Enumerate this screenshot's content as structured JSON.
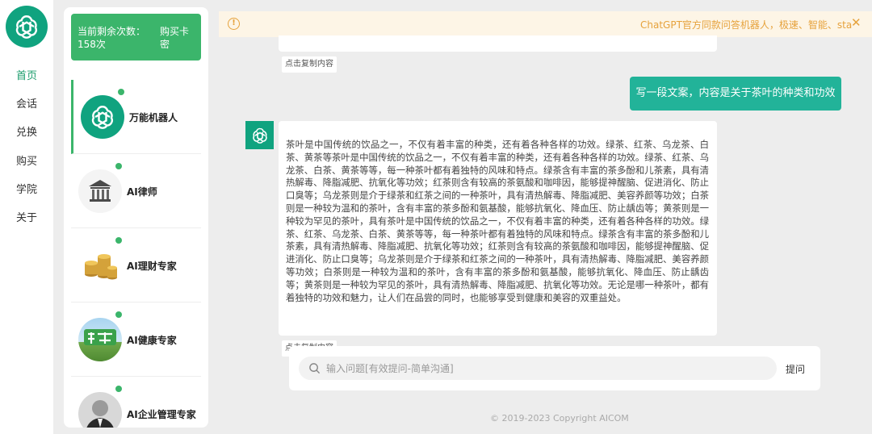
{
  "nav": {
    "logo_icon": "openai-logo-icon",
    "items": [
      {
        "label": "首页",
        "active": true
      },
      {
        "label": "会话"
      },
      {
        "label": "兑换"
      },
      {
        "label": "购买"
      },
      {
        "label": "学院"
      },
      {
        "label": "关于"
      }
    ]
  },
  "credits": {
    "count_label": "当前剩余次数：158次",
    "buy_label": "购买卡密"
  },
  "bots": [
    {
      "name": "万能机器人",
      "icon": "openai-logo-icon",
      "active": true
    },
    {
      "name": "AI律师",
      "icon": "courthouse-icon"
    },
    {
      "name": "AI理财专家",
      "icon": "coins-icon"
    },
    {
      "name": "AI健康专家",
      "icon": "health-icon"
    },
    {
      "name": "AI企业管理专家",
      "icon": "person-portrait-icon"
    }
  ],
  "notice": {
    "text": "ChatGPT官方同款问答机器人，极速、智能、stable",
    "close_icon": "close-icon",
    "warn_icon": "warning-icon"
  },
  "chat": {
    "copy_label": "点击复制内容",
    "user_message": "写一段文案，内容是关于茶叶的种类和功效",
    "bot_message": "茶叶是中国传统的饮品之一，不仅有着丰富的种类，还有着各种各样的功效。绿茶、红茶、乌龙茶、白茶、黄茶等茶叶是中国传统的饮品之一，不仅有着丰富的种类，还有着各种各样的功效。绿茶、红茶、乌龙茶、白茶、黄茶等等，每一种茶叶都有着独特的风味和特点。绿茶含有丰富的茶多酚和儿茶素，具有清热解毒、降脂减肥、抗氧化等功效；红茶则含有较高的茶氨酸和咖啡因，能够提神醒脑、促进消化、防止口臭等；乌龙茶则是介于绿茶和红茶之间的一种茶叶，具有清热解毒、降脂减肥、美容养颜等功效；白茶则是一种较为温和的茶叶，含有丰富的茶多酚和氨基酸，能够抗氧化、降血压、防止龋齿等；黄茶则是一种较为罕见的茶叶，具有茶叶是中国传统的饮品之一，不仅有着丰富的种类，还有着各种各样的功效。绿茶、红茶、乌龙茶、白茶、黄茶等等，每一种茶叶都有着独特的风味和特点。绿茶含有丰富的茶多酚和儿茶素，具有清热解毒、降脂减肥、抗氧化等功效；红茶则含有较高的茶氨酸和咖啡因，能够提神醒脑、促进消化、防止口臭等；乌龙茶则是介于绿茶和红茶之间的一种茶叶，具有清热解毒、降脂减肥、美容养颜等功效；白茶则是一种较为温和的茶叶，含有丰富的茶多酚和氨基酸，能够抗氧化、降血压、防止龋齿等；黄茶则是一种较为罕见的茶叶，具有清热解毒、降脂减肥、抗氧化等功效。无论是哪一种茶叶，都有着独特的功效和魅力，让人们在品尝的同时，也能够享受到健康和美容的双重益处。"
  },
  "input": {
    "placeholder": "输入问题[有效提问-简单沟通]",
    "ask_label": "提问",
    "search_icon": "search-icon"
  },
  "footer": "© 2019-2023 Copyright AICOM",
  "colors": {
    "primary_green": "#3bb56b",
    "teal": "#22b399",
    "openai_green": "#10a37f",
    "notice_orange": "#e6a23c"
  }
}
